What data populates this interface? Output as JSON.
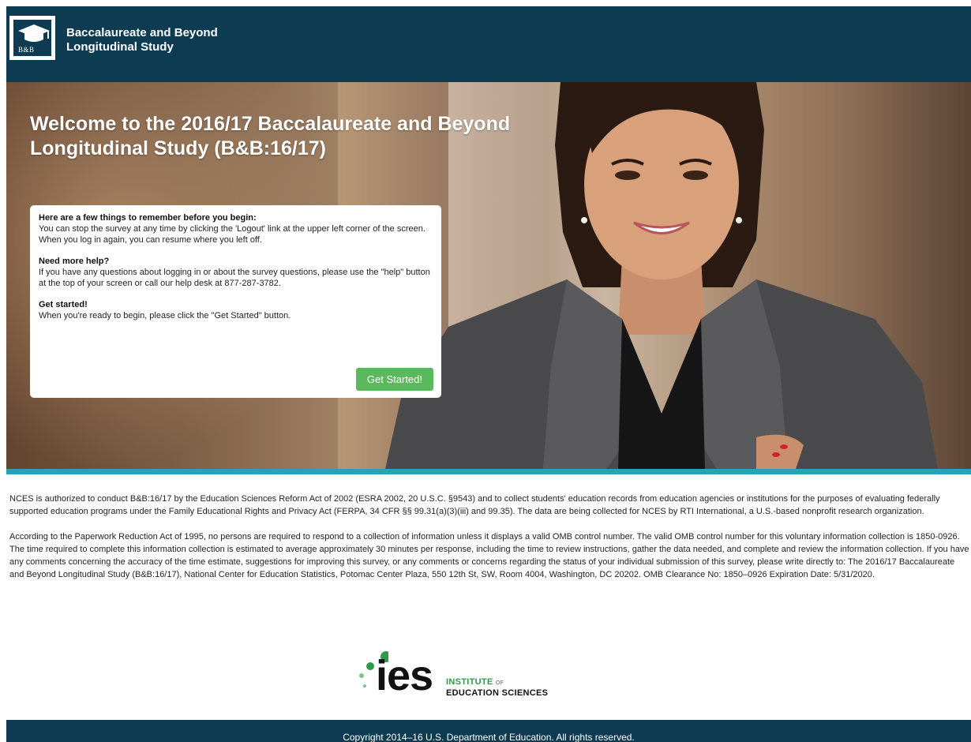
{
  "header": {
    "logo_text": "B&B",
    "title_line1": "Baccalaureate and Beyond",
    "title_line2": "Longitudinal Study"
  },
  "hero": {
    "title": "Welcome to the 2016/17 Baccalaureate and Beyond Longitudinal Study (B&B:16/17)"
  },
  "info_card": {
    "heading1": "Here are a few things to remember before you begin:",
    "text1": "You can stop the survey at any time by clicking the 'Logout' link at the upper left corner of the screen. When you log in again, you can resume where you left off.",
    "heading2": "Need more help?",
    "text2": "If you have any questions about logging in or about the survey questions, please use the \"help\" button at the top of your screen or call our help desk at 877-287-3782.",
    "heading3": "Get started!",
    "text3": "When you're ready to begin, please click the \"Get Started\" button.",
    "button_label": "Get Started!"
  },
  "legal": {
    "paragraph1": "NCES is authorized to conduct B&B:16/17 by the Education Sciences Reform Act of 2002 (ESRA 2002, 20 U.S.C. §9543) and to collect students' education records from education agencies or institutions for the purposes of evaluating federally supported education programs under the Family Educational Rights and Privacy Act (FERPA, 34 CFR §§ 99.31(a)(3)(iii) and 99.35). The data are being collected for NCES by RTI International, a U.S.-based nonprofit research organization.",
    "paragraph2": "According to the Paperwork Reduction Act of 1995, no persons are required to respond to a collection of information unless it displays a valid OMB control number. The valid OMB control number for this voluntary information collection is 1850-0926. The time required to complete this information collection is estimated to average approximately 30 minutes per response, including the time to review instructions, gather the data needed, and complete and review the information collection. If you have any comments concerning the accuracy of the time estimate, suggestions for improving this survey, or any comments or concerns regarding the status of your individual submission of this survey, please write directly to: The 2016/17 Baccalaureate and Beyond Longitudinal Study (B&B:16/17), National Center for Education Statistics, Potomac Center Plaza, 550 12th St, SW, Room 4004, Washington, DC 20202. OMB Clearance No: 1850–0926 Expiration Date: 5/31/2020."
  },
  "ies": {
    "mark": "ies",
    "institute": "INSTITUTE",
    "of": "OF",
    "education_sciences": "EDUCATION SCIENCES"
  },
  "footer": {
    "copyright": "Copyright 2014–16 U.S. Department of Education. All rights reserved."
  },
  "colors": {
    "header_bg": "#0d3b52",
    "accent_teal": "#27a3b6",
    "button_green": "#5cb85c",
    "ies_green": "#2e9b4a"
  }
}
